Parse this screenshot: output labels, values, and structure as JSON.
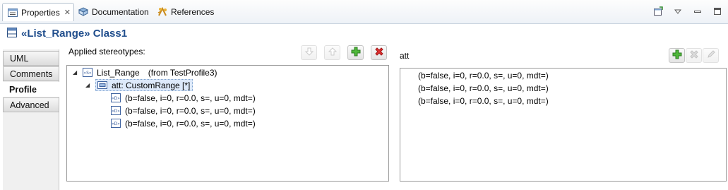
{
  "tabs": [
    {
      "label": "Properties",
      "close": "✕"
    },
    {
      "label": "Documentation"
    },
    {
      "label": "References"
    }
  ],
  "view_toolbar": {
    "icons": [
      "new-window-icon",
      "view-menu-icon",
      "minimize-icon",
      "maximize-icon"
    ]
  },
  "title": "«List_Range» Class1",
  "sections": [
    "UML",
    "Comments",
    "Profile",
    "Advanced"
  ],
  "applied": {
    "label": "Applied stereotypes:",
    "buttons": [
      "move-down-icon",
      "move-up-icon",
      "add-icon",
      "remove-icon"
    ],
    "tree": {
      "root": {
        "name": "List_Range",
        "source": "(from TestProfile3)"
      },
      "property": "att: CustomRange [*]",
      "values": [
        "(b=false, i=0, r=0.0, s=, u=0, mdt=)",
        "(b=false, i=0, r=0.0, s=, u=0, mdt=)",
        "(b=false, i=0, r=0.0, s=, u=0, mdt=)"
      ]
    }
  },
  "detail": {
    "label": "att",
    "buttons": [
      "add-icon",
      "remove-icon",
      "edit-icon"
    ],
    "values": [
      "(b=false, i=0, r=0.0, s=, u=0, mdt=)",
      "(b=false, i=0, r=0.0, s=, u=0, mdt=)",
      "(b=false, i=0, r=0.0, s=, u=0, mdt=)"
    ]
  },
  "colors": {
    "title": "#1f4d8c",
    "add": "#3a9a2a",
    "remove": "#d21f1f",
    "selection": "#dde9fa"
  }
}
